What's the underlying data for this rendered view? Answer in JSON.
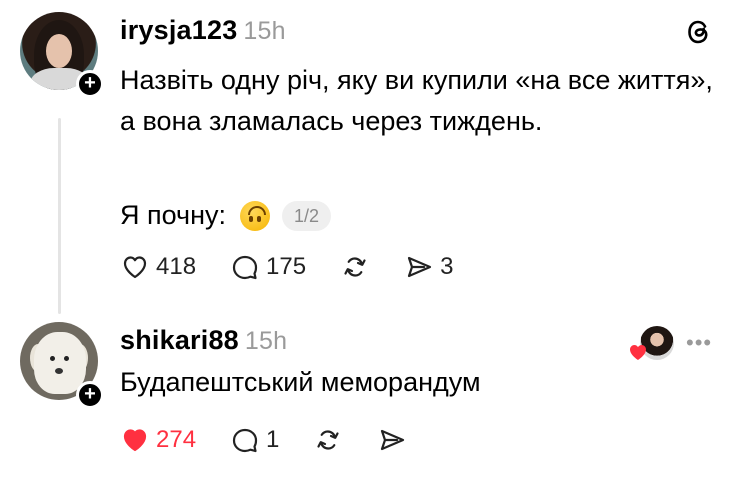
{
  "post1": {
    "username": "irysja123",
    "time": "15h",
    "text": "Назвіть одну річ, яку ви купили «на все життя», а вона зламалась через тиждень.",
    "start_text": "Я почну:",
    "page_indicator": "1/2",
    "actions": {
      "likes": "418",
      "comments": "175",
      "shares": "3"
    }
  },
  "post2": {
    "username": "shikari88",
    "time": "15h",
    "text": "Будапештський меморандум",
    "actions": {
      "likes": "274",
      "comments": "1"
    }
  },
  "colors": {
    "like_red": "#ff3040",
    "muted": "#9a9a9a",
    "thread_line": "#e4e4e4"
  },
  "icons": [
    "threads-logo-icon",
    "plus-icon",
    "heart-icon",
    "comment-icon",
    "repost-icon",
    "share-icon",
    "more-icon"
  ]
}
